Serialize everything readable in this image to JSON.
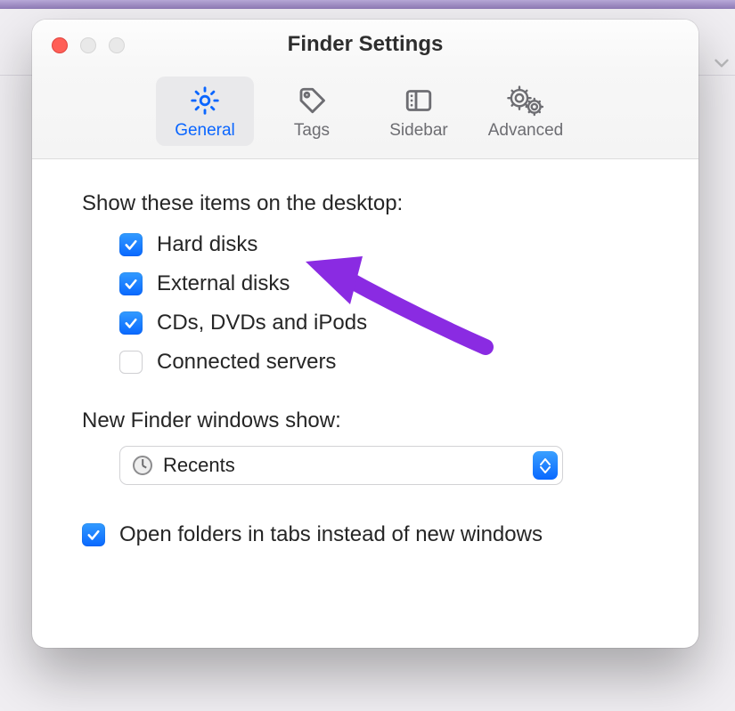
{
  "window": {
    "title": "Finder Settings"
  },
  "tabs": [
    {
      "label": "General",
      "selected": true
    },
    {
      "label": "Tags",
      "selected": false
    },
    {
      "label": "Sidebar",
      "selected": false
    },
    {
      "label": "Advanced",
      "selected": false
    }
  ],
  "section_desktop": {
    "label": "Show these items on the desktop:",
    "items": [
      {
        "label": "Hard disks",
        "checked": true
      },
      {
        "label": "External disks",
        "checked": true
      },
      {
        "label": "CDs, DVDs and iPods",
        "checked": true
      },
      {
        "label": "Connected servers",
        "checked": false
      }
    ]
  },
  "section_newwindow": {
    "label": "New Finder windows show:",
    "value": "Recents"
  },
  "open_in_tabs": {
    "label": "Open folders in tabs instead of new windows",
    "checked": true
  },
  "colors": {
    "accent": "#0968ff",
    "annotation": "#8a2be2"
  }
}
